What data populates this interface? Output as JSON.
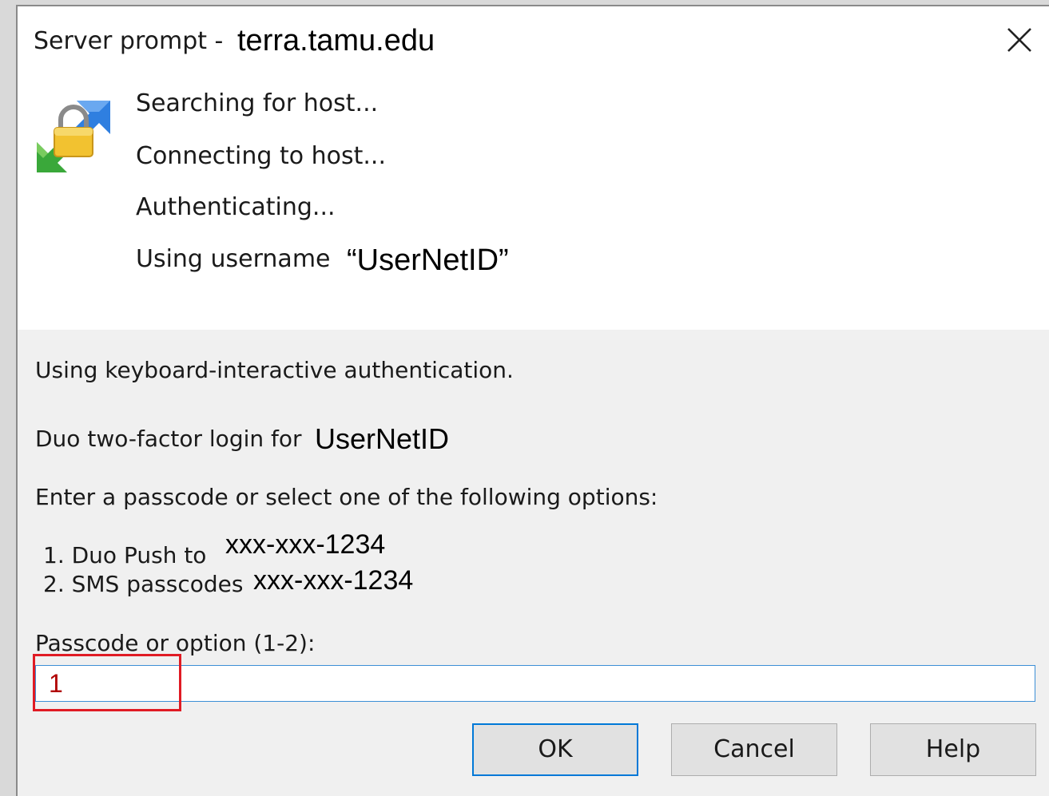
{
  "window": {
    "title_prefix": "Server prompt -",
    "title_host": "terra.tamu.edu",
    "close_icon": "close-icon"
  },
  "progress": {
    "icon": "secure-connection-icon",
    "searching": "Searching for host...",
    "connecting": "Connecting to host...",
    "authenticating": "Authenticating...",
    "using_username_label": "Using username",
    "username_quoted": "“UserNetID”"
  },
  "auth": {
    "method_text": "Using keyboard-interactive authentication.",
    "duo_label": "Duo two-factor login for",
    "duo_user": "UserNetID",
    "instructions": "Enter a passcode or select one of the following options:",
    "options": [
      {
        "label": "1. Duo Push to",
        "phone": "xxx-xxx-1234"
      },
      {
        "label": "2. SMS passcodes",
        "phone": "xxx-xxx-1234"
      }
    ],
    "prompt_label": "Passcode or option (1-2):",
    "input_value": "1"
  },
  "buttons": {
    "ok": "OK",
    "cancel": "Cancel",
    "help": "Help"
  },
  "colors": {
    "highlight": "#e01b24",
    "focus": "#0078d7",
    "panel_bg": "#f0f0f0"
  }
}
